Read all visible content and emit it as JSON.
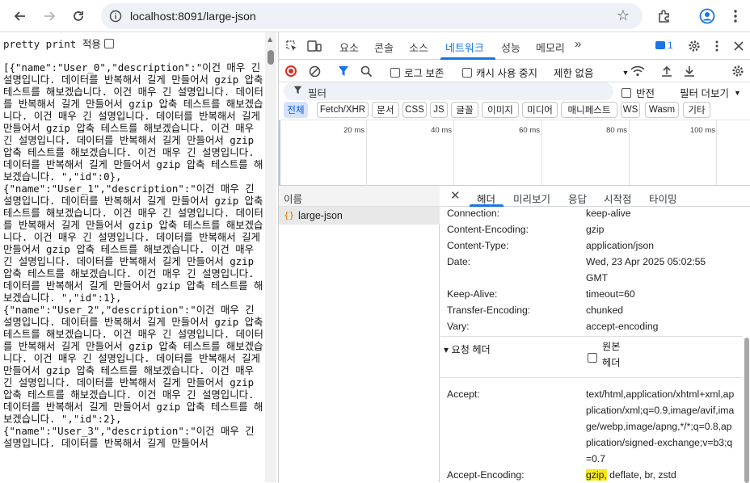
{
  "browser": {
    "url": "localhost:8091/large-json",
    "icons": [
      "back-arrow-icon",
      "forward-arrow-icon",
      "reload-icon",
      "site-info-icon",
      "bookmark-star-icon",
      "extensions-icon",
      "profile-icon",
      "menu-kebab-icon"
    ]
  },
  "page": {
    "pretty_print_label": "pretty print 적용",
    "pretty_print_checked": false,
    "json_text": "[{\"name\":\"User_0\",\"description\":\"이건 매우 긴 설명입니다. 데이터를 반복해서 길게 만들어서 gzip 압축 테스트를 해보겠습니다. 이건 매우 긴 설명입니다. 데이터를 반복해서 길게 만들어서 gzip 압축 테스트를 해보겠습니다. 이건 매우 긴 설명입니다. 데이터를 반복해서 길게 만들어서 gzip 압축 테스트를 해보겠습니다. 이건 매우 긴 설명입니다. 데이터를 반복해서 길게 만들어서 gzip 압축 테스트를 해보겠습니다. 이건 매우 긴 설명입니다. 데이터를 반복해서 길게 만들어서 gzip 압축 테스트를 해보겠습니다. \",\"id\":0},\n{\"name\":\"User_1\",\"description\":\"이건 매우 긴 설명입니다. 데이터를 반복해서 길게 만들어서 gzip 압축 테스트를 해보겠습니다. 이건 매우 긴 설명입니다. 데이터를 반복해서 길게 만들어서 gzip 압축 테스트를 해보겠습니다. 이건 매우 긴 설명입니다. 데이터를 반복해서 길게 만들어서 gzip 압축 테스트를 해보겠습니다. 이건 매우 긴 설명입니다. 데이터를 반복해서 길게 만들어서 gzip 압축 테스트를 해보겠습니다. 이건 매우 긴 설명입니다. 데이터를 반복해서 길게 만들어서 gzip 압축 테스트를 해보겠습니다. \",\"id\":1},\n{\"name\":\"User_2\",\"description\":\"이건 매우 긴 설명입니다. 데이터를 반복해서 길게 만들어서 gzip 압축 테스트를 해보겠습니다. 이건 매우 긴 설명입니다. 데이터를 반복해서 길게 만들어서 gzip 압축 테스트를 해보겠습니다. 이건 매우 긴 설명입니다. 데이터를 반복해서 길게 만들어서 gzip 압축 테스트를 해보겠습니다. 이건 매우 긴 설명입니다. 데이터를 반복해서 길게 만들어서 gzip 압축 테스트를 해보겠습니다. 이건 매우 긴 설명입니다. 데이터를 반복해서 길게 만들어서 gzip 압축 테스트를 해보겠습니다. \",\"id\":2},\n{\"name\":\"User_3\",\"description\":\"이건 매우 긴 설명입니다. 데이터를 반복해서 길게 만들어서"
  },
  "devtools": {
    "tabs": [
      "요소",
      "콘솔",
      "소스",
      "네트워크",
      "성능",
      "메모리"
    ],
    "active_tab": "네트워크",
    "more_tabs": "»",
    "issues_count": "1",
    "toolbar": {
      "preserve_log": "로그 보존",
      "disable_cache": "캐시 사용 중지",
      "throttle": "제한 없음"
    },
    "filter": {
      "placeholder": "필터",
      "invert": "반전",
      "more_filters": "필터 더보기"
    },
    "chips": [
      "전체",
      "Fetch/XHR",
      "문서",
      "CSS",
      "JS",
      "글꼴",
      "이미지",
      "미디어",
      "매니페스트",
      "WS",
      "Wasm",
      "기타"
    ],
    "active_chip": "전체",
    "timeline_labels": [
      "20 ms",
      "40 ms",
      "60 ms",
      "80 ms",
      "100 ms"
    ],
    "requests": {
      "column_name": "이름",
      "items": [
        {
          "name": "large-json",
          "icon": "json-braces-icon"
        }
      ]
    },
    "details": {
      "tabs": [
        "헤더",
        "미리보기",
        "응답",
        "시작점",
        "타이밍"
      ],
      "active_tab": "헤더",
      "response_headers": [
        {
          "key": "Connection:",
          "value": "keep-alive"
        },
        {
          "key": "Content-Encoding:",
          "value": "gzip"
        },
        {
          "key": "Content-Type:",
          "value": "application/json"
        },
        {
          "key": "Date:",
          "value": "Wed, 23 Apr 2025 05:02:55 GMT"
        },
        {
          "key": "Keep-Alive:",
          "value": "timeout=60"
        },
        {
          "key": "Transfer-Encoding:",
          "value": "chunked"
        },
        {
          "key": "Vary:",
          "value": "accept-encoding"
        }
      ],
      "request_section": {
        "title": "▾ 요청 헤더",
        "raw_label_1": "원본",
        "raw_label_2": "헤더",
        "raw_checked": false
      },
      "request_headers": [
        {
          "key": "Accept:",
          "value": "text/html,application/xhtml+xml,application/xml;q=0.9,image/avif,image/webp,image/apng,*/*;q=0.8,application/signed-exchange;v=b3;q=0.7"
        },
        {
          "key": "Accept-Encoding:",
          "value_highlight": "gzip,",
          "value_rest": " deflate, br, zstd"
        }
      ]
    }
  }
}
